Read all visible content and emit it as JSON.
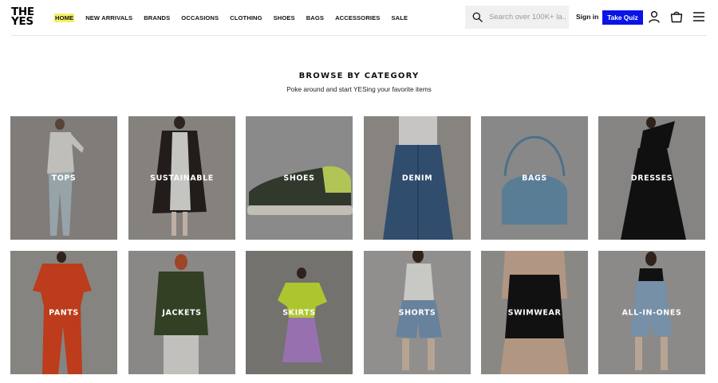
{
  "header": {
    "logo_line1": "THE",
    "logo_line2": "YES",
    "nav": [
      "HOME",
      "NEW ARRIVALS",
      "BRANDS",
      "OCCASIONS",
      "CLOTHING",
      "SHOES",
      "BAGS",
      "ACCESSORIES",
      "SALE"
    ],
    "search_placeholder": "Search over 100K+ la...",
    "sign_in": "Sign in",
    "take_quiz": "Take Quiz",
    "icons": [
      "search-icon",
      "user-icon",
      "bag-icon",
      "menu-icon"
    ]
  },
  "section": {
    "title": "BROWSE BY CATEGORY",
    "subtitle": "Poke around and start YESing your favorite items"
  },
  "categories": [
    {
      "label": "TOPS",
      "bg": "#8c8a88"
    },
    {
      "label": "SUSTAINABLE",
      "bg": "#8e8b88"
    },
    {
      "label": "SHOES",
      "bg": "#8f8f8f"
    },
    {
      "label": "DENIM",
      "bg": "#8a8886"
    },
    {
      "label": "BAGS",
      "bg": "#909090"
    },
    {
      "label": "DRESSES",
      "bg": "#8b8a89"
    },
    {
      "label": "PANTS",
      "bg": "#8c8b89"
    },
    {
      "label": "JACKETS",
      "bg": "#8d8c8a"
    },
    {
      "label": "SKIRTS",
      "bg": "#7d7b79"
    },
    {
      "label": "SHORTS",
      "bg": "#8e8d8c"
    },
    {
      "label": "SWIMWEAR",
      "bg": "#8b8987"
    },
    {
      "label": "ALL-IN-ONES",
      "bg": "#8d8c8b"
    }
  ],
  "colors": {
    "accent": "#0a14e6",
    "highlight": "#f3f06a"
  }
}
